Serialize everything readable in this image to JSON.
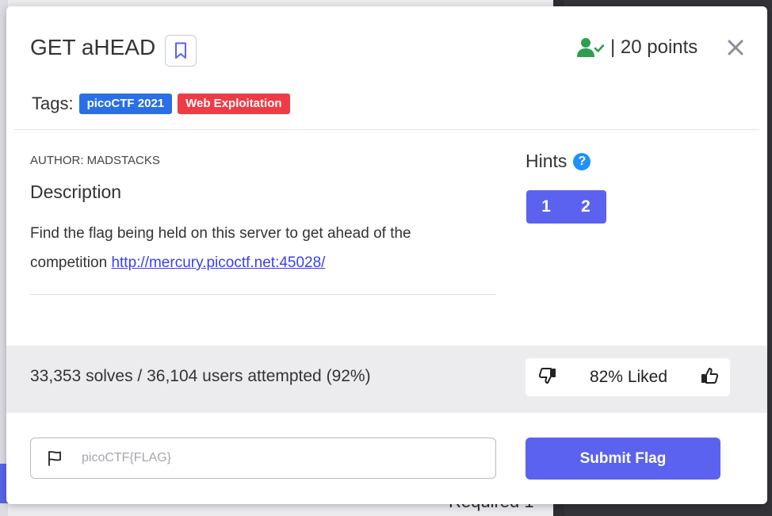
{
  "challenge": {
    "title": "GET aHEAD",
    "points_label": "| 20 points",
    "tags_label": "Tags:",
    "tags": [
      "picoCTF 2021",
      "Web Exploitation"
    ],
    "author": "AUTHOR: MADSTACKS",
    "description_heading": "Description",
    "description_text": "Find the flag being held on this server to get ahead of the competition ",
    "description_link": "http://mercury.picoctf.net:45028/"
  },
  "hints": {
    "title": "Hints",
    "help_glyph": "?",
    "buttons": [
      "1",
      "2"
    ]
  },
  "stats": {
    "solves_text": "33,353 solves / 36,104 users attempted (92%)",
    "liked_text": "82% Liked",
    "liked_percent": 82
  },
  "flag_form": {
    "placeholder": "picoCTF{FLAG}",
    "value": "",
    "submit_label": "Submit Flag"
  },
  "background": {
    "partial_text": "Required 1"
  },
  "colors": {
    "primary": "#5b62ef",
    "tag_blue": "#2a6fe6",
    "tag_red": "#ee3b45",
    "solved_green": "#2e9e4f",
    "help_blue": "#1e90ff",
    "link": "#3a3ff0"
  },
  "icons": {
    "bookmark": "bookmark-icon",
    "solved": "user-check-icon",
    "close": "close-icon",
    "help": "help-circle-icon",
    "dislike": "thumbs-down-icon",
    "like": "thumbs-up-icon",
    "flag": "flag-icon"
  }
}
